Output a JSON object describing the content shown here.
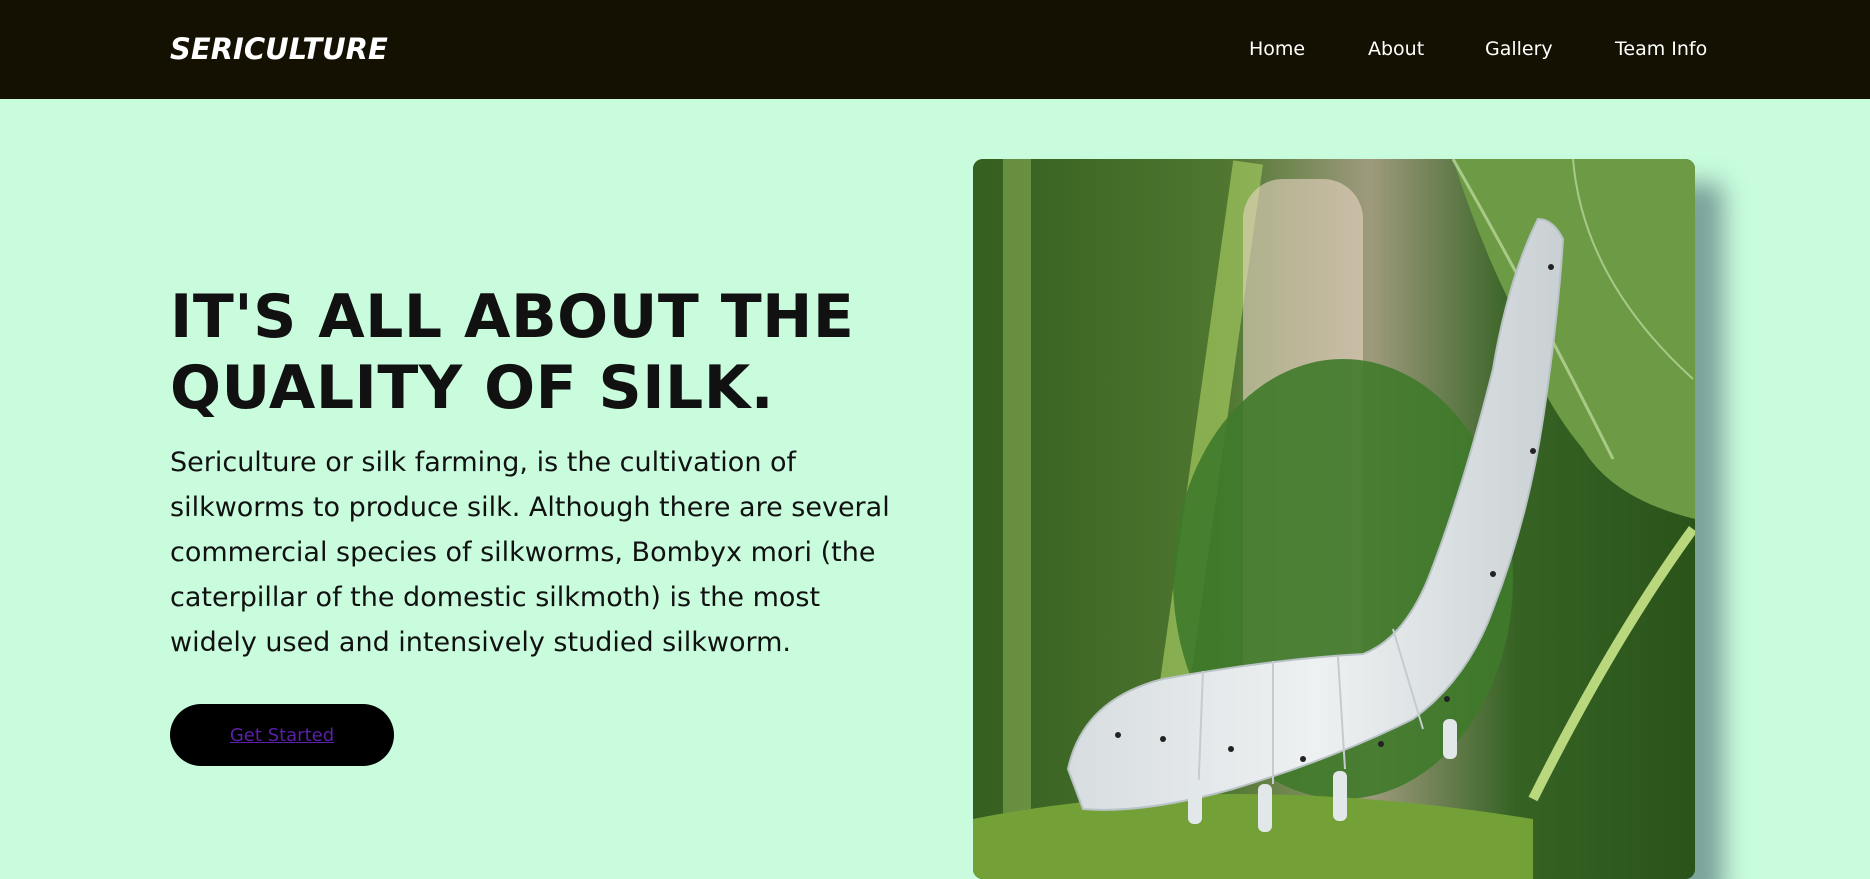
{
  "navbar": {
    "brand": "SERICULTURE",
    "links": [
      "Home",
      "About",
      "Gallery",
      "Team Info"
    ]
  },
  "hero": {
    "title_line1": "IT'S ALL ABOUT THE",
    "title_line2": "QUALITY OF SILK.",
    "body_lines": [
      "Sericulture or silk farming, is the cultivation of",
      "silkworms to produce silk. Although there are several",
      "commercial species of silkworms, Bombyx mori (the",
      "caterpillar of the domestic silkmoth) is the most",
      "widely used and intensively studied silkworm."
    ],
    "cta_label": "Get Started"
  },
  "colors": {
    "nav_bg": "#151102",
    "page_bg": "#c8fcdd",
    "button_bg": "#000000",
    "button_text": "#5b1fa8"
  }
}
